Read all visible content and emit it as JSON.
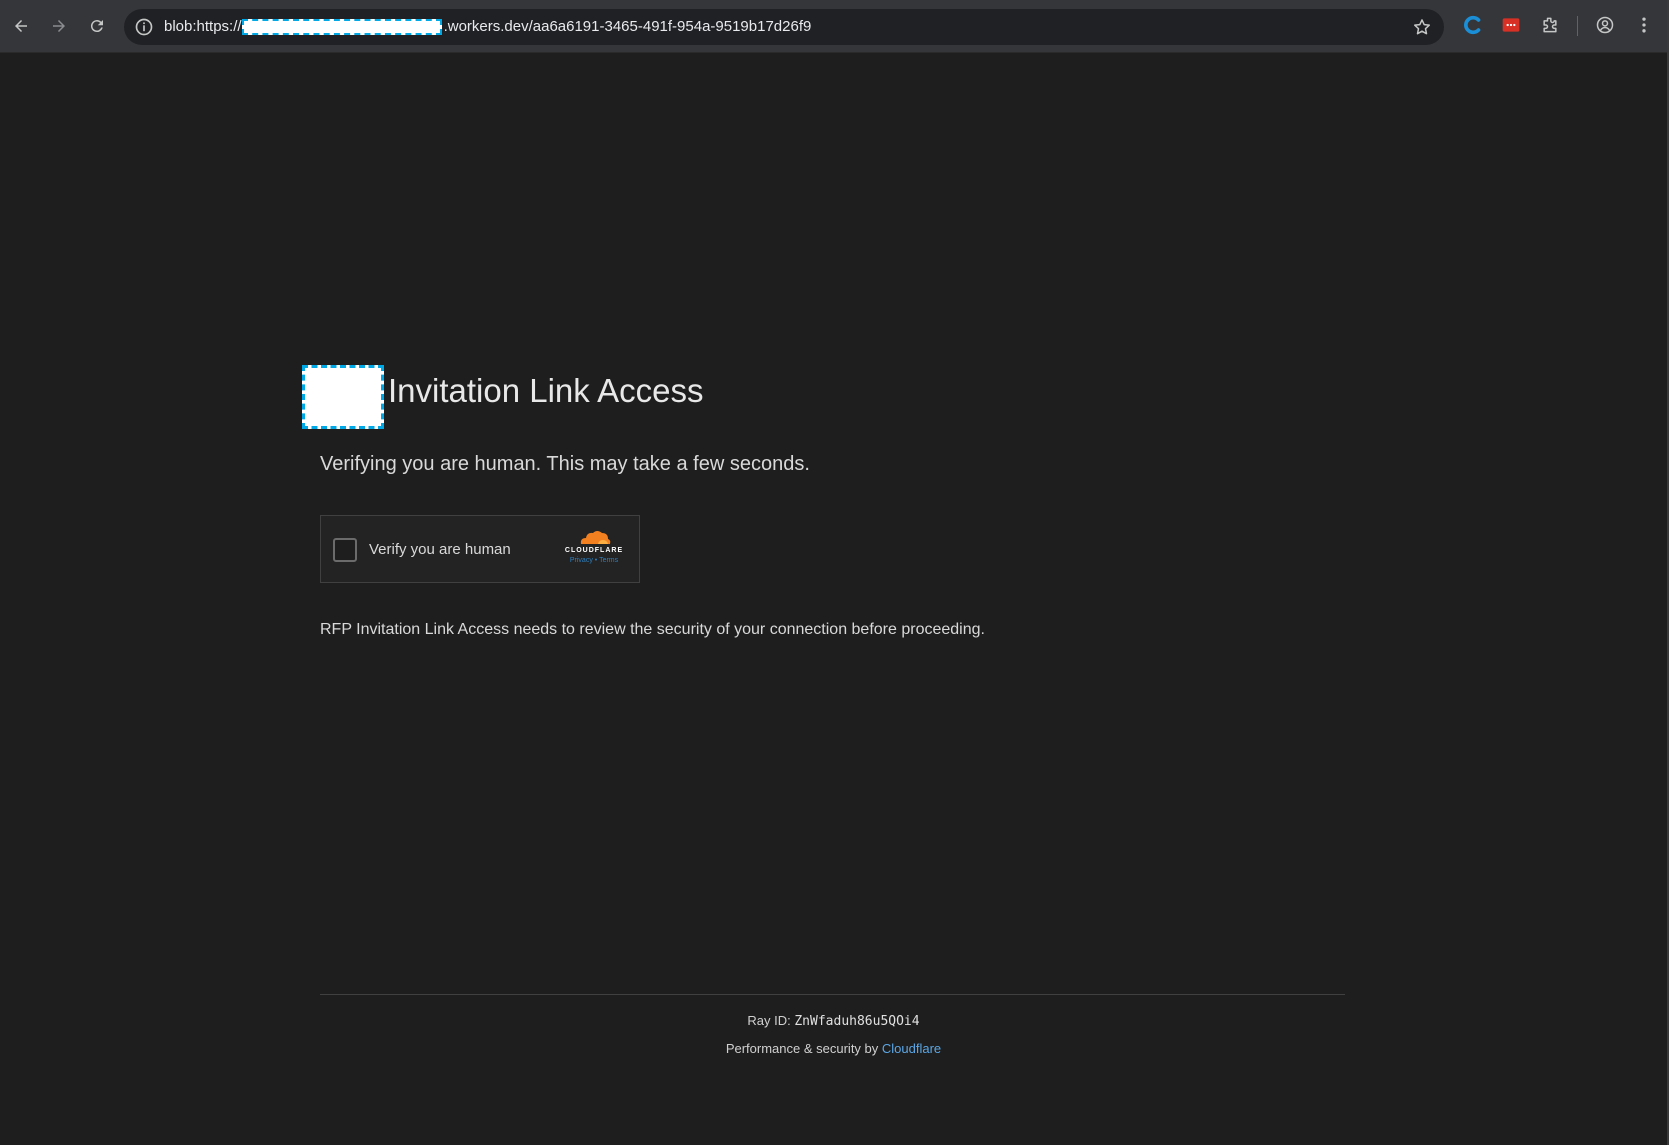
{
  "browser": {
    "url_prefix": "blob:https://",
    "url_suffix": ".workers.dev/aa6a6191-3465-491f-954a-9519b17d26f9",
    "icons": {
      "back": "arrow-left-icon",
      "forward": "arrow-right-icon",
      "reload": "reload-icon",
      "site_info": "info-icon",
      "bookmark": "star-icon",
      "extensions": "puzzle-icon",
      "profile": "account-icon",
      "menu": "kebab-menu-icon"
    }
  },
  "page": {
    "title": "Invitation Link Access",
    "subtitle": "Verifying you are human. This may take a few seconds.",
    "notice": "RFP Invitation Link Access needs to review the security of your connection before proceeding."
  },
  "challenge": {
    "checkbox_label": "Verify you are human",
    "brand": "CLOUDFLARE",
    "privacy_link": "Privacy",
    "separator": "•",
    "terms_link": "Terms"
  },
  "footer": {
    "ray_label": "Ray ID: ",
    "ray_id": "ZnWfaduh86u5QOi4",
    "perf_label": "Performance & security by ",
    "perf_link": "Cloudflare"
  },
  "colors": {
    "page_background": "#1e1e1e",
    "browser_toolbar": "#35363a",
    "cloudflare_orange": "#f38020",
    "link_blue": "#5ba7e6",
    "redaction_border": "#00a9e6"
  }
}
